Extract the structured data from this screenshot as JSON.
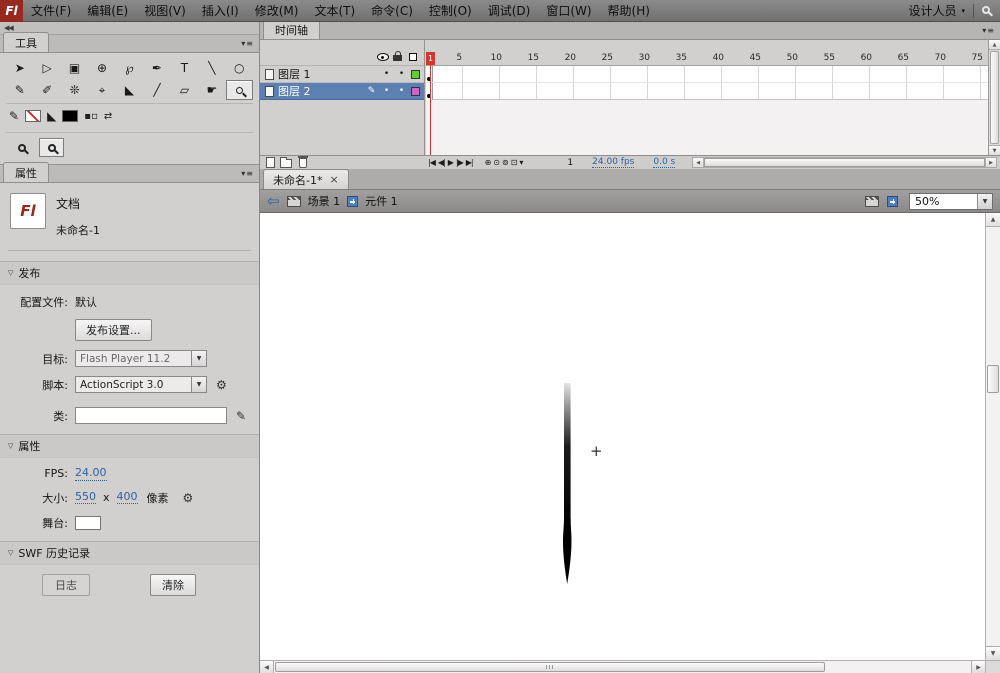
{
  "menubar": {
    "logo": "Fl",
    "items": [
      "文件(F)",
      "编辑(E)",
      "视图(V)",
      "插入(I)",
      "修改(M)",
      "文本(T)",
      "命令(C)",
      "控制(O)",
      "调试(D)",
      "窗口(W)",
      "帮助(H)"
    ],
    "workspace": "设计人员"
  },
  "panels": {
    "tools_title": "工具",
    "properties_title": "属性",
    "timeline_title": "时间轴"
  },
  "tools": {
    "row1": [
      {
        "name": "selection-tool",
        "glyph": "➤"
      },
      {
        "name": "subselection-tool",
        "glyph": "▷"
      },
      {
        "name": "free-transform-tool",
        "glyph": "▣"
      },
      {
        "name": "rotation-3d-tool",
        "glyph": "⊕"
      },
      {
        "name": "lasso-tool",
        "glyph": "℘"
      },
      {
        "name": "pen-tool",
        "glyph": "✒"
      },
      {
        "name": "text-tool",
        "glyph": "T"
      },
      {
        "name": "line-tool",
        "glyph": "╲"
      },
      {
        "name": "oval-tool",
        "glyph": "○"
      }
    ],
    "row2": [
      {
        "name": "pencil-tool",
        "glyph": "✎"
      },
      {
        "name": "brush-tool",
        "glyph": "✐"
      },
      {
        "name": "deco-tool",
        "glyph": "❊"
      },
      {
        "name": "bone-tool",
        "glyph": "⌖"
      },
      {
        "name": "paint-bucket-tool",
        "glyph": "◣"
      },
      {
        "name": "eyedropper-tool",
        "glyph": "╱"
      },
      {
        "name": "eraser-tool",
        "glyph": "▱"
      },
      {
        "name": "hand-tool",
        "glyph": "☛"
      },
      {
        "name": "zoom-tool",
        "icon": "mag",
        "selected": true
      }
    ],
    "fill_color": "#000000"
  },
  "properties": {
    "doc_type": "文档",
    "doc_name": "未命名-1",
    "sections": {
      "publish": "发布",
      "properties": "属性",
      "swf_history": "SWF 历史记录"
    },
    "profile_label": "配置文件:",
    "profile_value": "默认",
    "publish_settings_btn": "发布设置...",
    "target_label": "目标:",
    "target_value": "Flash Player 11.2",
    "script_label": "脚本:",
    "script_value": "ActionScript 3.0",
    "class_label": "类:",
    "class_value": "",
    "fps_label": "FPS:",
    "fps_value": "24.00",
    "size_label": "大小:",
    "size_width": "550",
    "size_times": "x",
    "size_height": "400",
    "size_unit": "像素",
    "stage_label": "舞台:",
    "stage_color": "#ffffff",
    "log_btn": "日志",
    "clear_btn": "清除"
  },
  "timeline": {
    "layers": [
      {
        "name": "图层 1",
        "color": "#66cc33",
        "selected": false,
        "active": false
      },
      {
        "name": "图层 2",
        "color": "#cc66cc",
        "selected": true,
        "active": true
      }
    ],
    "frame_numbers": [
      "5",
      "10",
      "15",
      "20",
      "25",
      "30",
      "35",
      "40",
      "45",
      "50",
      "55",
      "60",
      "65",
      "70",
      "75"
    ],
    "current_frame": "1",
    "frame_rate": "24.00 fps",
    "elapsed_time": "0.0 s",
    "playback": [
      {
        "name": "go-to-first-frame-button",
        "glyph": "|◀"
      },
      {
        "name": "step-back-button",
        "glyph": "◀|"
      },
      {
        "name": "play-button",
        "glyph": "▶"
      },
      {
        "name": "step-forward-button",
        "glyph": "|▶"
      },
      {
        "name": "go-to-last-frame-button",
        "glyph": "▶|"
      }
    ],
    "onion": [
      {
        "name": "center-frame-button",
        "glyph": "⊕"
      },
      {
        "name": "onion-skin-button",
        "glyph": "⊙"
      },
      {
        "name": "onion-skin-outlines-button",
        "glyph": "⊚"
      },
      {
        "name": "edit-multiple-frames-button",
        "glyph": "⊡"
      },
      {
        "name": "modify-markers-button",
        "glyph": "▾"
      }
    ]
  },
  "document": {
    "tab": "未命名-1*",
    "close": "×",
    "scene": "场景 1",
    "symbol": "元件 1",
    "zoom": "50%"
  },
  "icons": {
    "collapse": "◀◀",
    "panel_menu": "▾≡",
    "dropdown": "▼",
    "back": "⇦",
    "wrench": "⚙",
    "pencil": "✎",
    "workspace_arrow": "▾",
    "up": "▲",
    "down": "▼",
    "left": "◀",
    "right": "▶",
    "cross": "+"
  }
}
